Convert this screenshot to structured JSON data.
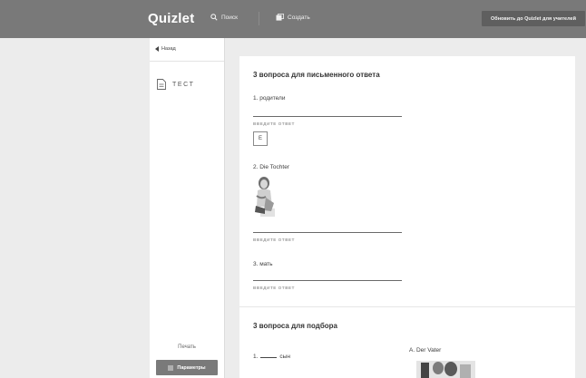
{
  "topbar": {
    "logo": "Quizlet",
    "search_label": "Поиск",
    "create_label": "Создать",
    "upgrade_label": "Обновить до Quizlet для учителей"
  },
  "sidebar": {
    "back_label": "Назад",
    "test_label": "ТЕСТ",
    "print_label": "Печать",
    "params_label": "Параметры"
  },
  "written": {
    "title": "3 вопроса для письменного ответа",
    "answer_hint": "ВВЕДИТЕ ОТВЕТ",
    "questions": [
      {
        "num": "1.",
        "text": "родители",
        "hint_letter": "E"
      },
      {
        "num": "2.",
        "text": "Die Tochter"
      },
      {
        "num": "3.",
        "text": "мать"
      }
    ]
  },
  "matching": {
    "title": "3 вопроса для подбора",
    "left_item": {
      "num": "1.",
      "text": "сын"
    },
    "right_item": {
      "letter": "A.",
      "text": "Der Vater"
    }
  }
}
